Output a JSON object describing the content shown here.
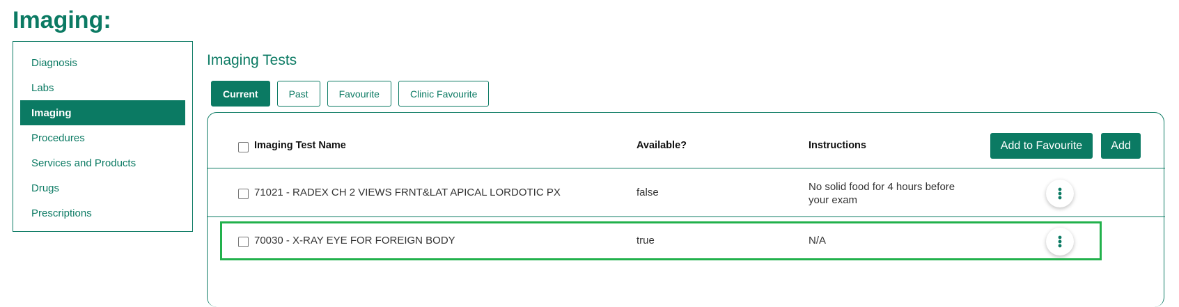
{
  "page": {
    "title": "Imaging:"
  },
  "sidebar": {
    "items": [
      {
        "label": "Diagnosis"
      },
      {
        "label": "Labs"
      },
      {
        "label": "Imaging"
      },
      {
        "label": "Procedures"
      },
      {
        "label": "Services and Products"
      },
      {
        "label": "Drugs"
      },
      {
        "label": "Prescriptions"
      }
    ],
    "active_item": "Imaging"
  },
  "main": {
    "title": "Imaging Tests",
    "tabs": [
      {
        "label": "Current"
      },
      {
        "label": "Past"
      },
      {
        "label": "Favourite"
      },
      {
        "label": "Clinic Favourite"
      }
    ],
    "active_tab": "Current"
  },
  "table": {
    "headers": {
      "name": "Imaging Test Name",
      "available": "Available?",
      "instructions": "Instructions"
    },
    "actions": {
      "add_to_favourite": "Add to Favourite",
      "add": "Add"
    },
    "rows": [
      {
        "name": "71021 - RADEX CH 2 VIEWS FRNT&LAT APICAL LORDOTIC PX",
        "available": "false",
        "instructions": "No solid food for 4 hours before your exam"
      },
      {
        "name": "70030 - X-RAY EYE FOR FOREIGN BODY",
        "available": "true",
        "instructions": "N/A"
      }
    ]
  },
  "colors": {
    "primary": "#0b7a63",
    "highlight": "#22b14c"
  },
  "icons": {
    "row_menu": "more-vertical-icon"
  }
}
